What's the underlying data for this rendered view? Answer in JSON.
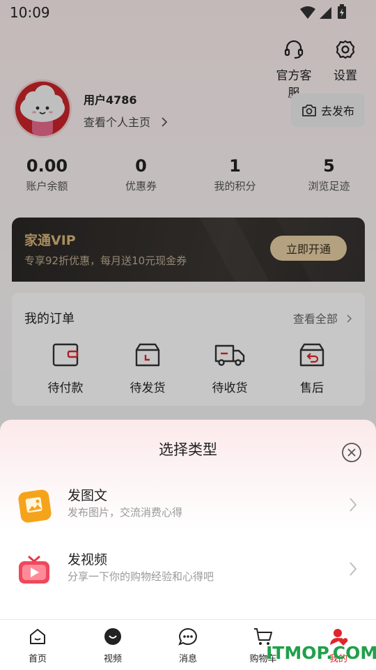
{
  "status_bar": {
    "time": "10:09"
  },
  "header": {
    "service_label": "官方客服",
    "settings_label": "设置"
  },
  "profile": {
    "username": "用户4786",
    "view_profile_label": "查看个人主页",
    "publish_label": "去发布"
  },
  "stats": [
    {
      "value": "0.00",
      "label": "账户余额"
    },
    {
      "value": "0",
      "label": "优惠券"
    },
    {
      "value": "1",
      "label": "我的积分"
    },
    {
      "value": "5",
      "label": "浏览足迹"
    }
  ],
  "vip": {
    "title": "家通VIP",
    "subtitle": "专享92折优惠，每月送10元现金券",
    "button_label": "立即开通"
  },
  "orders": {
    "title": "我的订单",
    "view_all_label": "查看全部",
    "items": [
      {
        "label": "待付款"
      },
      {
        "label": "待发货"
      },
      {
        "label": "待收货"
      },
      {
        "label": "售后"
      }
    ]
  },
  "sheet": {
    "title": "选择类型",
    "options": [
      {
        "title": "发图文",
        "subtitle": "发布图片，交流消费心得"
      },
      {
        "title": "发视频",
        "subtitle": "分享一下你的购物经验和心得吧"
      }
    ]
  },
  "tabbar": {
    "items": [
      {
        "label": "首页"
      },
      {
        "label": "视频"
      },
      {
        "label": "消息"
      },
      {
        "label": "购物车"
      },
      {
        "label": "我的"
      }
    ],
    "active_color": "#e0262b"
  },
  "watermark": "ITMOP.COM"
}
